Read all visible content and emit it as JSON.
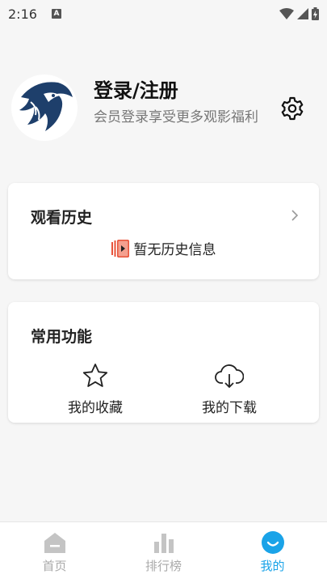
{
  "status_bar": {
    "time": "2:16",
    "notification_icon": "a-notification-icon",
    "icons": [
      "wifi-icon",
      "signal-icon",
      "battery-charging-icon"
    ]
  },
  "profile": {
    "name": "登录/注册",
    "subtitle": "会员登录享受更多观影福利",
    "avatar_icon": "eagle-logo-icon",
    "settings_icon": "gear-icon"
  },
  "history": {
    "title": "观看历史",
    "empty_text": "暂无历史信息"
  },
  "functions": {
    "title": "常用功能",
    "items": [
      {
        "label": "我的收藏",
        "icon": "star-icon"
      },
      {
        "label": "我的下载",
        "icon": "cloud-download-icon"
      }
    ]
  },
  "nav": {
    "items": [
      {
        "label": "首页",
        "icon": "home-icon",
        "active": false
      },
      {
        "label": "排行榜",
        "icon": "bar-chart-icon",
        "active": false
      },
      {
        "label": "我的",
        "icon": "smile-icon",
        "active": true
      }
    ]
  },
  "colors": {
    "accent": "#1aa3e8",
    "background": "#f6f6f6",
    "card": "#ffffff",
    "icon_history": "#e8533a"
  }
}
